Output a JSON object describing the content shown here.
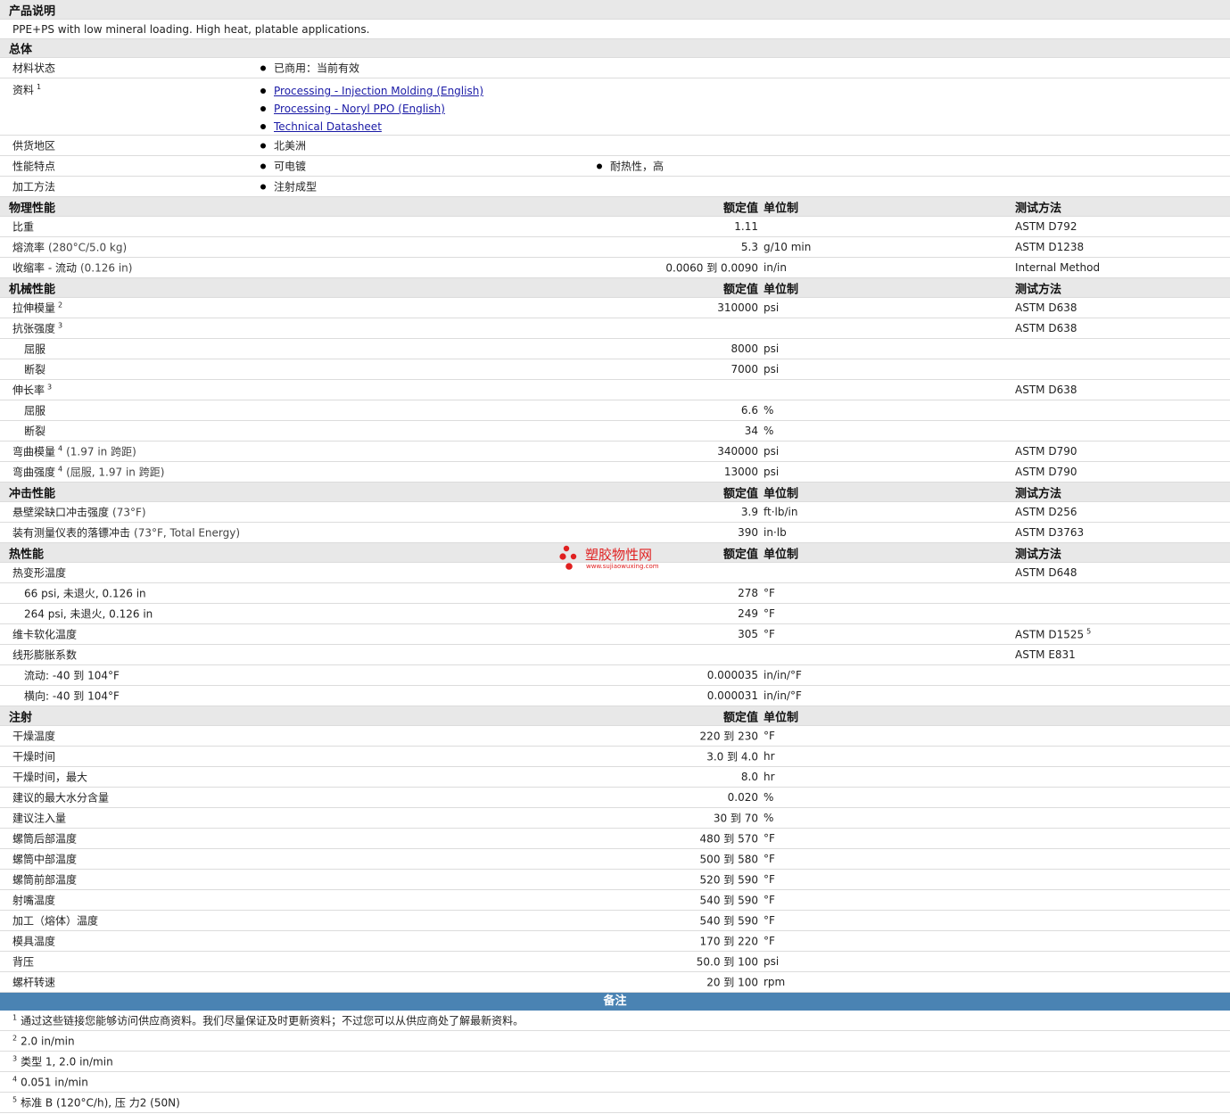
{
  "desc_section": {
    "title": "产品说明",
    "text": "PPE+PS with low mineral loading. High heat, platable applications."
  },
  "general": {
    "title": "总体",
    "material_status": {
      "label": "材料状态",
      "value": "已商用：当前有效"
    },
    "docs": {
      "label": "资料",
      "sup": "1",
      "links": [
        "Processing - Injection Molding (English)",
        "Processing - Noryl PPO (English)",
        "Technical Datasheet"
      ]
    },
    "region": {
      "label": "供货地区",
      "value": "北美洲"
    },
    "features": {
      "label": "性能特点",
      "values": [
        "可电镀",
        "耐热性，高"
      ]
    },
    "processing": {
      "label": "加工方法",
      "value": "注射成型"
    }
  },
  "headers": {
    "nominal": "额定值",
    "unit": "单位制",
    "test": "测试方法"
  },
  "sections": [
    {
      "title": "物理性能",
      "show_test": true,
      "rows": [
        {
          "label": "比重",
          "value": "1.11",
          "unit": "",
          "test": "ASTM D792",
          "h": 23
        },
        {
          "label": "熔流率",
          "cond": "(280°C/5.0 kg)",
          "value": "5.3",
          "unit": "g/10 min",
          "test": "ASTM D1238",
          "h": 23
        },
        {
          "label": "收缩率 - 流动",
          "cond": "(0.126 in)",
          "value": "0.0060 到  0.0090",
          "unit": "in/in",
          "test": "Internal Method",
          "h": 23
        }
      ]
    },
    {
      "title": "机械性能",
      "show_test": true,
      "rows": [
        {
          "label": "拉伸模量",
          "sup": "2",
          "value": "310000",
          "unit": "psi",
          "test": "ASTM D638",
          "h": 23
        },
        {
          "label": "抗张强度",
          "sup": "3",
          "value": "",
          "unit": "",
          "test": "ASTM D638",
          "h": 23
        },
        {
          "label": "屈服",
          "sub": true,
          "value": "8000",
          "unit": "psi",
          "test": "",
          "h": 23
        },
        {
          "label": "断裂",
          "sub": true,
          "value": "7000",
          "unit": "psi",
          "test": "",
          "h": 23
        },
        {
          "label": "伸长率",
          "sup": "3",
          "value": "",
          "unit": "",
          "test": "ASTM D638",
          "h": 23
        },
        {
          "label": "屈服",
          "sub": true,
          "value": "6.6",
          "unit": "%",
          "test": "",
          "h": 23
        },
        {
          "label": "断裂",
          "sub": true,
          "value": "34",
          "unit": "%",
          "test": "",
          "h": 23
        },
        {
          "label": "弯曲模量",
          "sup": "4",
          "cond": "(1.97 in 跨距)",
          "value": "340000",
          "unit": "psi",
          "test": "ASTM D790",
          "h": 23
        },
        {
          "label": "弯曲强度",
          "sup": "4",
          "cond": "(屈服, 1.97 in 跨距)",
          "value": "13000",
          "unit": "psi",
          "test": "ASTM D790",
          "h": 23
        }
      ]
    },
    {
      "title": "冲击性能",
      "show_test": true,
      "rows": [
        {
          "label": "悬壁梁缺口冲击强度",
          "cond": "(73°F)",
          "value": "3.9",
          "unit": "ft·lb/in",
          "test": "ASTM D256",
          "h": 23
        },
        {
          "label": "装有测量仪表的落镖冲击",
          "cond": "(73°F, Total Energy)",
          "value": "390",
          "unit": "in·lb",
          "test": "ASTM D3763",
          "h": 23
        }
      ]
    },
    {
      "title": "热性能",
      "show_test": true,
      "rows": [
        {
          "label": "热变形温度",
          "value": "",
          "unit": "",
          "test": "ASTM D648",
          "h": 23
        },
        {
          "label": "66 psi, 未退火, 0.126 in",
          "sub": true,
          "value": "278",
          "unit": "°F",
          "test": "",
          "h": 23
        },
        {
          "label": "264 psi, 未退火, 0.126 in",
          "sub": true,
          "value": "249",
          "unit": "°F",
          "test": "",
          "h": 23
        },
        {
          "label": "维卡软化温度",
          "value": "305",
          "unit": "°F",
          "test": "ASTM D1525",
          "test_sup": "5",
          "h": 23
        },
        {
          "label": "线形膨胀系数",
          "value": "",
          "unit": "",
          "test": "ASTM E831",
          "h": 23
        },
        {
          "label": "流动: -40 到  104°F",
          "sub": true,
          "value": "0.000035",
          "unit": "in/in/°F",
          "test": "",
          "h": 23
        },
        {
          "label": "横向: -40 到  104°F",
          "sub": true,
          "value": "0.000031",
          "unit": "in/in/°F",
          "test": "",
          "h": 23
        }
      ]
    },
    {
      "title": "注射",
      "show_test": false,
      "rows": [
        {
          "label": "干燥温度",
          "value": "220 到  230",
          "unit": "°F",
          "test": "",
          "h": 23
        },
        {
          "label": "干燥时间",
          "value": "3.0 到  4.0",
          "unit": "hr",
          "test": "",
          "h": 23
        },
        {
          "label": "干燥时间，最大",
          "value": "8.0",
          "unit": "hr",
          "test": "",
          "h": 23
        },
        {
          "label": "建议的最大水分含量",
          "value": "0.020",
          "unit": "%",
          "test": "",
          "h": 23
        },
        {
          "label": "建议注入量",
          "value": "30 到  70",
          "unit": "%",
          "test": "",
          "h": 23
        },
        {
          "label": "螺筒后部温度",
          "value": "480 到  570",
          "unit": "°F",
          "test": "",
          "h": 23
        },
        {
          "label": "螺筒中部温度",
          "value": "500 到  580",
          "unit": "°F",
          "test": "",
          "h": 23
        },
        {
          "label": "螺筒前部温度",
          "value": "520 到  590",
          "unit": "°F",
          "test": "",
          "h": 23
        },
        {
          "label": "射嘴温度",
          "value": "540 到  590",
          "unit": "°F",
          "test": "",
          "h": 23
        },
        {
          "label": "加工（熔体）温度",
          "value": "540 到  590",
          "unit": "°F",
          "test": "",
          "h": 23
        },
        {
          "label": "模具温度",
          "value": "170 到  220",
          "unit": "°F",
          "test": "",
          "h": 23
        },
        {
          "label": "背压",
          "value": "50.0 到  100",
          "unit": "psi",
          "test": "",
          "h": 23
        },
        {
          "label": "螺杆转速",
          "value": "20 到  100",
          "unit": "rpm",
          "test": "",
          "h": 23
        }
      ]
    }
  ],
  "notes": {
    "title": "备注",
    "items": [
      {
        "sup": "1",
        "text": "通过这些链接您能够访问供应商资料。我们尽量保证及时更新资料；不过您可以从供应商处了解最新资料。"
      },
      {
        "sup": "2",
        "text": "2.0 in/min"
      },
      {
        "sup": "3",
        "text": "类型  1, 2.0 in/min"
      },
      {
        "sup": "4",
        "text": "0.051 in/min"
      },
      {
        "sup": "5",
        "text": "标准  B (120°C/h), 压  力2 (50N)"
      }
    ]
  },
  "watermark": {
    "text": "塑胶物性网",
    "url": "www.sujiaowuxing.com",
    "color": "#e02020"
  }
}
